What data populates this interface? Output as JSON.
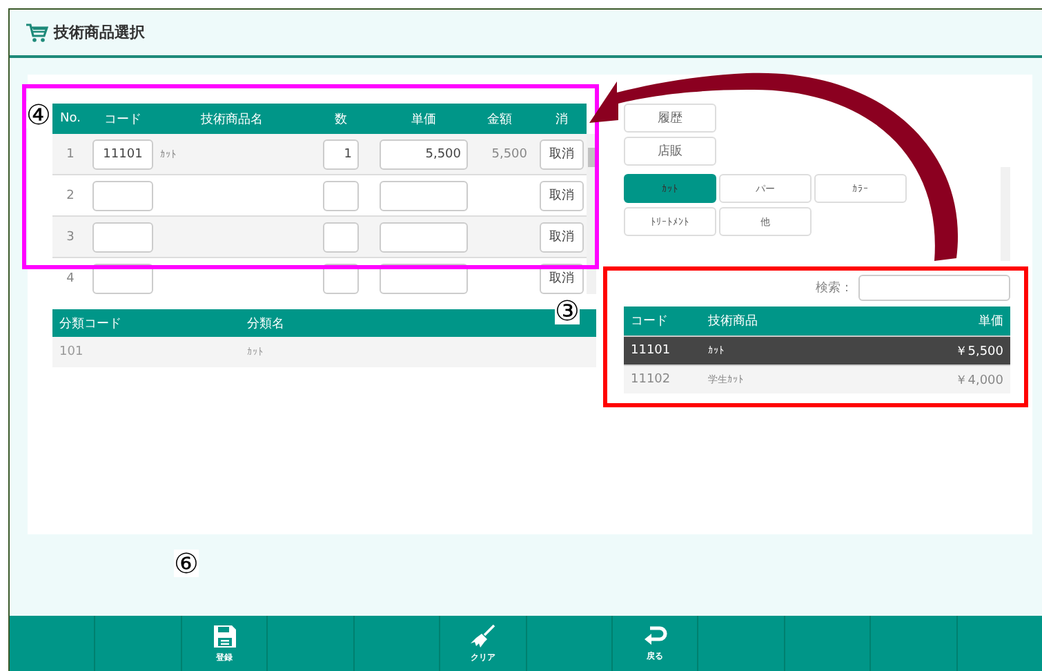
{
  "window": {
    "title": "技術商品選択"
  },
  "order_table": {
    "columns": [
      "No.",
      "コード",
      "技術商品名",
      "数",
      "単価",
      "金額",
      "消"
    ],
    "rows": [
      {
        "no": "1",
        "code": "11101",
        "name": "ｶｯﾄ",
        "qty": "1",
        "price": "5,500",
        "amount": "5,500",
        "cancel": "取消"
      },
      {
        "no": "2",
        "code": "",
        "name": "",
        "qty": "",
        "price": "",
        "amount": "",
        "cancel": "取消"
      },
      {
        "no": "3",
        "code": "",
        "name": "",
        "qty": "",
        "price": "",
        "amount": "",
        "cancel": "取消"
      },
      {
        "no": "4",
        "code": "",
        "name": "",
        "qty": "",
        "price": "",
        "amount": "",
        "cancel": "取消"
      }
    ]
  },
  "category_table": {
    "columns": [
      "分類コード",
      "分類名"
    ],
    "rows": [
      {
        "code": "101",
        "name": "ｶｯﾄ"
      }
    ]
  },
  "history_buttons": [
    "履歴",
    "店販"
  ],
  "category_tabs": [
    {
      "label": "ｶｯﾄ",
      "selected": true
    },
    {
      "label": "パー",
      "selected": false
    },
    {
      "label": "ｶﾗｰ",
      "selected": false
    },
    {
      "label": "ﾄﾘｰﾄﾒﾝﾄ",
      "selected": false
    },
    {
      "label": "他",
      "selected": false
    }
  ],
  "search": {
    "label": "検索："
  },
  "product_table": {
    "columns": [
      "コード",
      "技術商品",
      "単価"
    ],
    "rows": [
      {
        "code": "11101",
        "name": "ｶｯﾄ",
        "price": "￥5,500",
        "selected": true
      },
      {
        "code": "11102",
        "name": "学生ｶｯﾄ",
        "price": "￥4,000",
        "selected": false
      }
    ]
  },
  "footer": [
    {
      "kind": "blank"
    },
    {
      "kind": "blank"
    },
    {
      "kind": "save",
      "label": "登録"
    },
    {
      "kind": "blank"
    },
    {
      "kind": "blank"
    },
    {
      "kind": "clear",
      "label": "クリア"
    },
    {
      "kind": "blank"
    },
    {
      "kind": "back",
      "label": "戻る"
    },
    {
      "kind": "blank"
    },
    {
      "kind": "blank"
    },
    {
      "kind": "blank"
    },
    {
      "kind": "blank"
    }
  ],
  "annotations": {
    "markers": [
      {
        "label": "④"
      },
      {
        "label": "③"
      },
      {
        "label": "⑥"
      }
    ],
    "boxes": [
      {
        "color": "#ff00ff"
      },
      {
        "color": "#ff0000"
      }
    ]
  }
}
